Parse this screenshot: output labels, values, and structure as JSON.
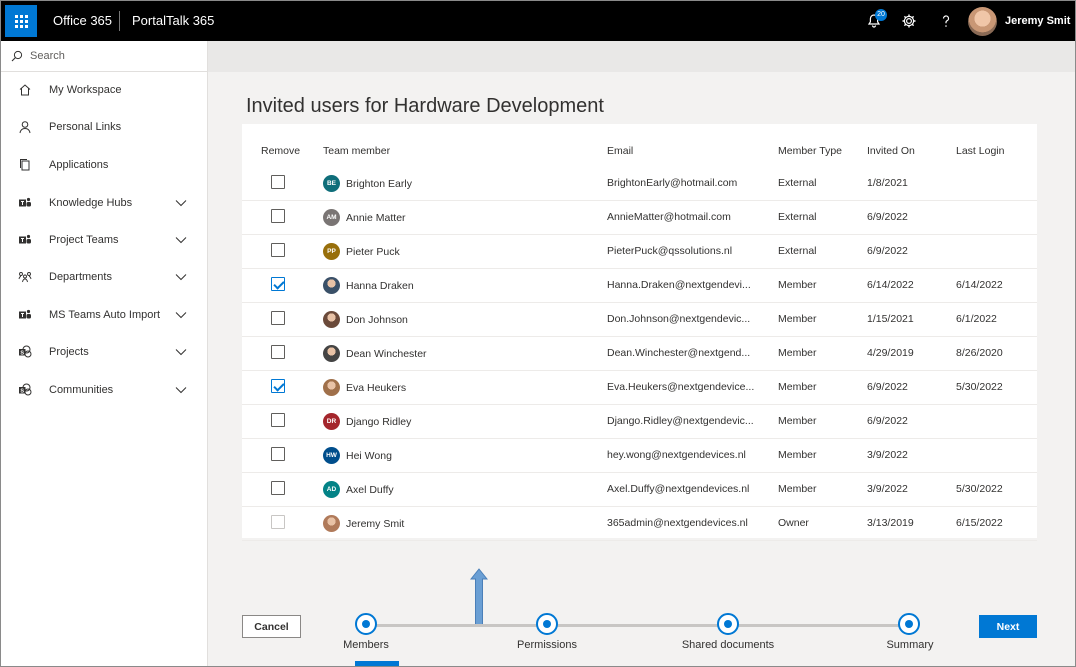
{
  "header": {
    "app1": "Office 365",
    "app2": "PortalTalk 365",
    "notification_count": "20",
    "user_name": "Jeremy Smit"
  },
  "sidebar": {
    "search_placeholder": "Search",
    "items": [
      {
        "label": "My Workspace",
        "icon": "home-icon",
        "expandable": false
      },
      {
        "label": "Personal Links",
        "icon": "person-icon",
        "expandable": false
      },
      {
        "label": "Applications",
        "icon": "copy-icon",
        "expandable": false
      },
      {
        "label": "Knowledge Hubs",
        "icon": "teams-icon",
        "expandable": true
      },
      {
        "label": "Project Teams",
        "icon": "teams-icon",
        "expandable": true
      },
      {
        "label": "Departments",
        "icon": "org-icon",
        "expandable": true
      },
      {
        "label": "MS Teams Auto Import",
        "icon": "teams-icon",
        "expandable": true
      },
      {
        "label": "Projects",
        "icon": "sharepoint-icon",
        "expandable": true
      },
      {
        "label": "Communities",
        "icon": "sharepoint-icon",
        "expandable": true
      }
    ]
  },
  "main": {
    "title": "Invited users for Hardware Development",
    "columns": {
      "remove": "Remove",
      "member": "Team member",
      "email": "Email",
      "type": "Member Type",
      "invited": "Invited On",
      "login": "Last Login"
    },
    "rows": [
      {
        "checked": false,
        "disabled": false,
        "initials": "BE",
        "avatar_color": "#0f6e7a",
        "avatar_type": "initials",
        "name": "Brighton Early",
        "email": "BrightonEarly@hotmail.com",
        "type": "External",
        "invited": "1/8/2021",
        "login": ""
      },
      {
        "checked": false,
        "disabled": false,
        "initials": "AM",
        "avatar_color": "#7a7574",
        "avatar_type": "initials",
        "name": "Annie Matter",
        "email": "AnnieMatter@hotmail.com",
        "type": "External",
        "invited": "6/9/2022",
        "login": ""
      },
      {
        "checked": false,
        "disabled": false,
        "initials": "PP",
        "avatar_color": "#986f0b",
        "avatar_type": "initials",
        "name": "Pieter Puck",
        "email": "PieterPuck@qssolutions.nl",
        "type": "External",
        "invited": "6/9/2022",
        "login": ""
      },
      {
        "checked": true,
        "disabled": false,
        "initials": "",
        "avatar_color": "#3a5068",
        "avatar_type": "photo",
        "name": "Hanna Draken",
        "email": "Hanna.Draken@nextgendevi...",
        "type": "Member",
        "invited": "6/14/2022",
        "login": "6/14/2022"
      },
      {
        "checked": false,
        "disabled": false,
        "initials": "",
        "avatar_color": "#6b4a3a",
        "avatar_type": "photo",
        "name": "Don Johnson",
        "email": "Don.Johnson@nextgendevic...",
        "type": "Member",
        "invited": "1/15/2021",
        "login": "6/1/2022"
      },
      {
        "checked": false,
        "disabled": false,
        "initials": "",
        "avatar_color": "#444444",
        "avatar_type": "photo",
        "name": "Dean Winchester",
        "email": "Dean.Winchester@nextgend...",
        "type": "Member",
        "invited": "4/29/2019",
        "login": "8/26/2020"
      },
      {
        "checked": true,
        "disabled": false,
        "initials": "",
        "avatar_color": "#a0704a",
        "avatar_type": "photo",
        "name": "Eva Heukers",
        "email": "Eva.Heukers@nextgendevice...",
        "type": "Member",
        "invited": "6/9/2022",
        "login": "5/30/2022"
      },
      {
        "checked": false,
        "disabled": false,
        "initials": "DR",
        "avatar_color": "#a4262c",
        "avatar_type": "initials",
        "name": "Django Ridley",
        "email": "Django.Ridley@nextgendevic...",
        "type": "Member",
        "invited": "6/9/2022",
        "login": ""
      },
      {
        "checked": false,
        "disabled": false,
        "initials": "HW",
        "avatar_color": "#004e8c",
        "avatar_type": "initials",
        "name": "Hei Wong",
        "email": "hey.wong@nextgendevices.nl",
        "type": "Member",
        "invited": "3/9/2022",
        "login": ""
      },
      {
        "checked": false,
        "disabled": false,
        "initials": "AD",
        "avatar_color": "#038387",
        "avatar_type": "initials",
        "name": "Axel Duffy",
        "email": "Axel.Duffy@nextgendevices.nl",
        "type": "Member",
        "invited": "3/9/2022",
        "login": "5/30/2022"
      },
      {
        "checked": false,
        "disabled": true,
        "initials": "",
        "avatar_color": "#b07a5a",
        "avatar_type": "photo",
        "name": "Jeremy Smit",
        "email": "365admin@nextgendevices.nl",
        "type": "Owner",
        "invited": "3/13/2019",
        "login": "6/15/2022"
      }
    ]
  },
  "footer": {
    "cancel_label": "Cancel",
    "next_label": "Next",
    "steps": [
      "Members",
      "Permissions",
      "Shared documents",
      "Summary"
    ]
  },
  "colors": {
    "accent": "#0078d4",
    "topbar": "#000000",
    "arrow": "#6a9fd4"
  }
}
